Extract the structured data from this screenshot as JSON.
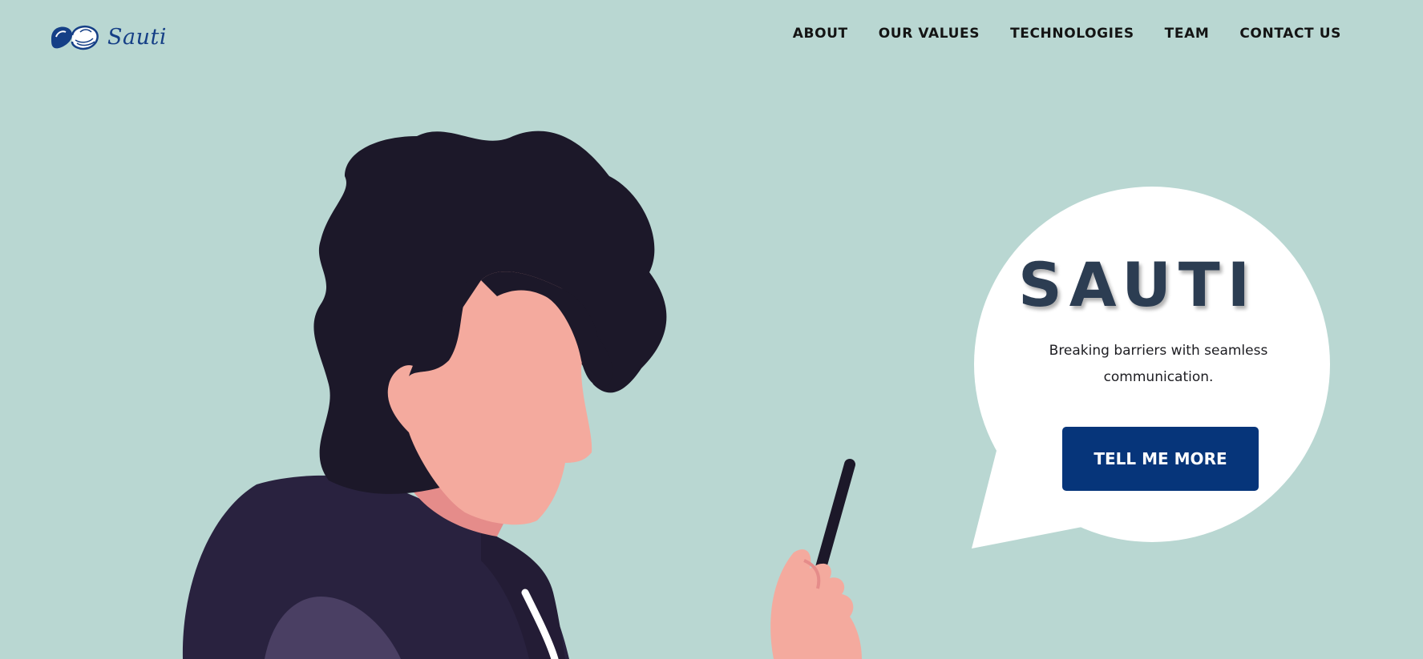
{
  "brand": {
    "name": "Sauti",
    "logo_icon": "hands-speech-icon",
    "color": "#153f86"
  },
  "nav": {
    "items": [
      {
        "label": "ABOUT"
      },
      {
        "label": "OUR VALUES"
      },
      {
        "label": "TECHNOLOGIES"
      },
      {
        "label": "TEAM"
      },
      {
        "label": "CONTACT US"
      }
    ]
  },
  "hero": {
    "title": "SAUTI",
    "subtitle": "Breaking barriers with seamless communication.",
    "cta_label": "TELL ME MORE",
    "cta_color": "#06357a"
  },
  "theme": {
    "background": "#b9d7d2",
    "bubble": "#ffffff",
    "hair": "#1c1829",
    "hoodie": "#29223f",
    "skin": "#f4aa9e"
  }
}
